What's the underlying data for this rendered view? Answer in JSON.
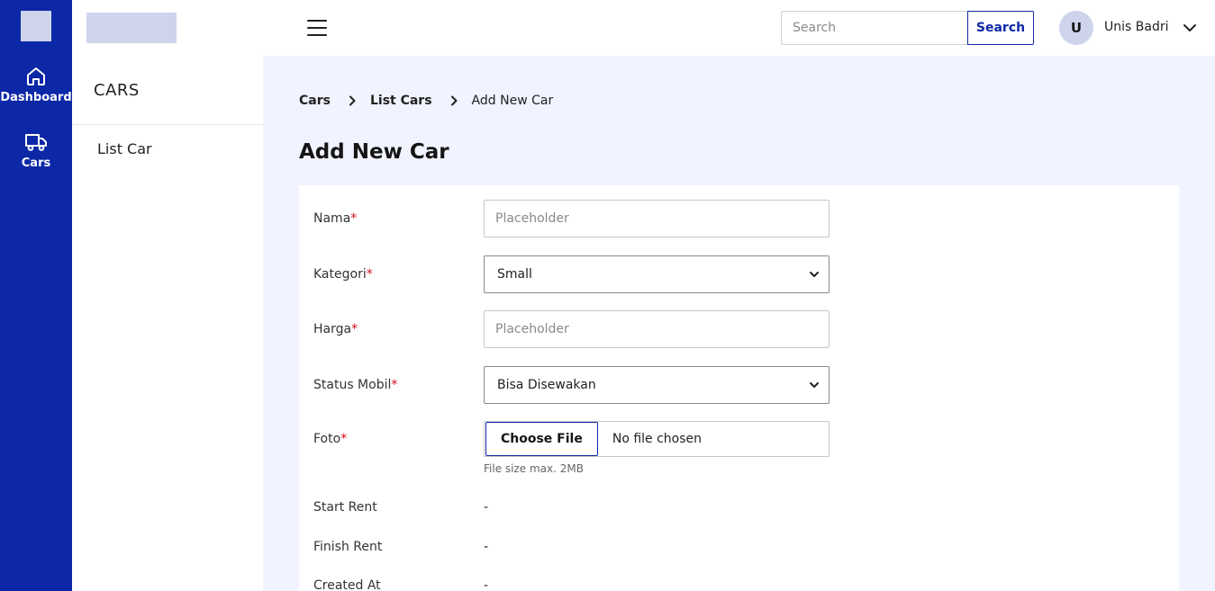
{
  "rail": {
    "items": [
      {
        "label": "Dashboard",
        "icon": "home-icon"
      },
      {
        "label": "Cars",
        "icon": "truck-icon"
      }
    ]
  },
  "sidebar": {
    "title": "CARS",
    "items": [
      {
        "label": "List Car"
      }
    ]
  },
  "topbar": {
    "search_placeholder": "Search",
    "search_button": "Search",
    "avatar_initial": "U",
    "user_name": "Unis Badri"
  },
  "breadcrumb": [
    "Cars",
    "List Cars",
    "Add New Car"
  ],
  "page_title": "Add New Car",
  "form": {
    "nama": {
      "label": "Nama",
      "placeholder": "Placeholder",
      "value": ""
    },
    "kategori": {
      "label": "Kategori",
      "value": "Small"
    },
    "harga": {
      "label": "Harga",
      "placeholder": "Placeholder",
      "value": ""
    },
    "status": {
      "label": "Status Mobil",
      "value": "Bisa Disewakan"
    },
    "foto": {
      "label": "Foto",
      "button": "Choose File",
      "status": "No file chosen",
      "hint": "File size max. 2MB"
    },
    "required_marker": "*",
    "info": [
      {
        "label": "Start Rent",
        "value": "-"
      },
      {
        "label": "Finish Rent",
        "value": "-"
      },
      {
        "label": "Created At",
        "value": "-"
      }
    ]
  },
  "colors": {
    "primary": "#0D28A6",
    "light": "#CFD4ED",
    "background": "#F1F3FF",
    "required": "#D00C1A"
  }
}
